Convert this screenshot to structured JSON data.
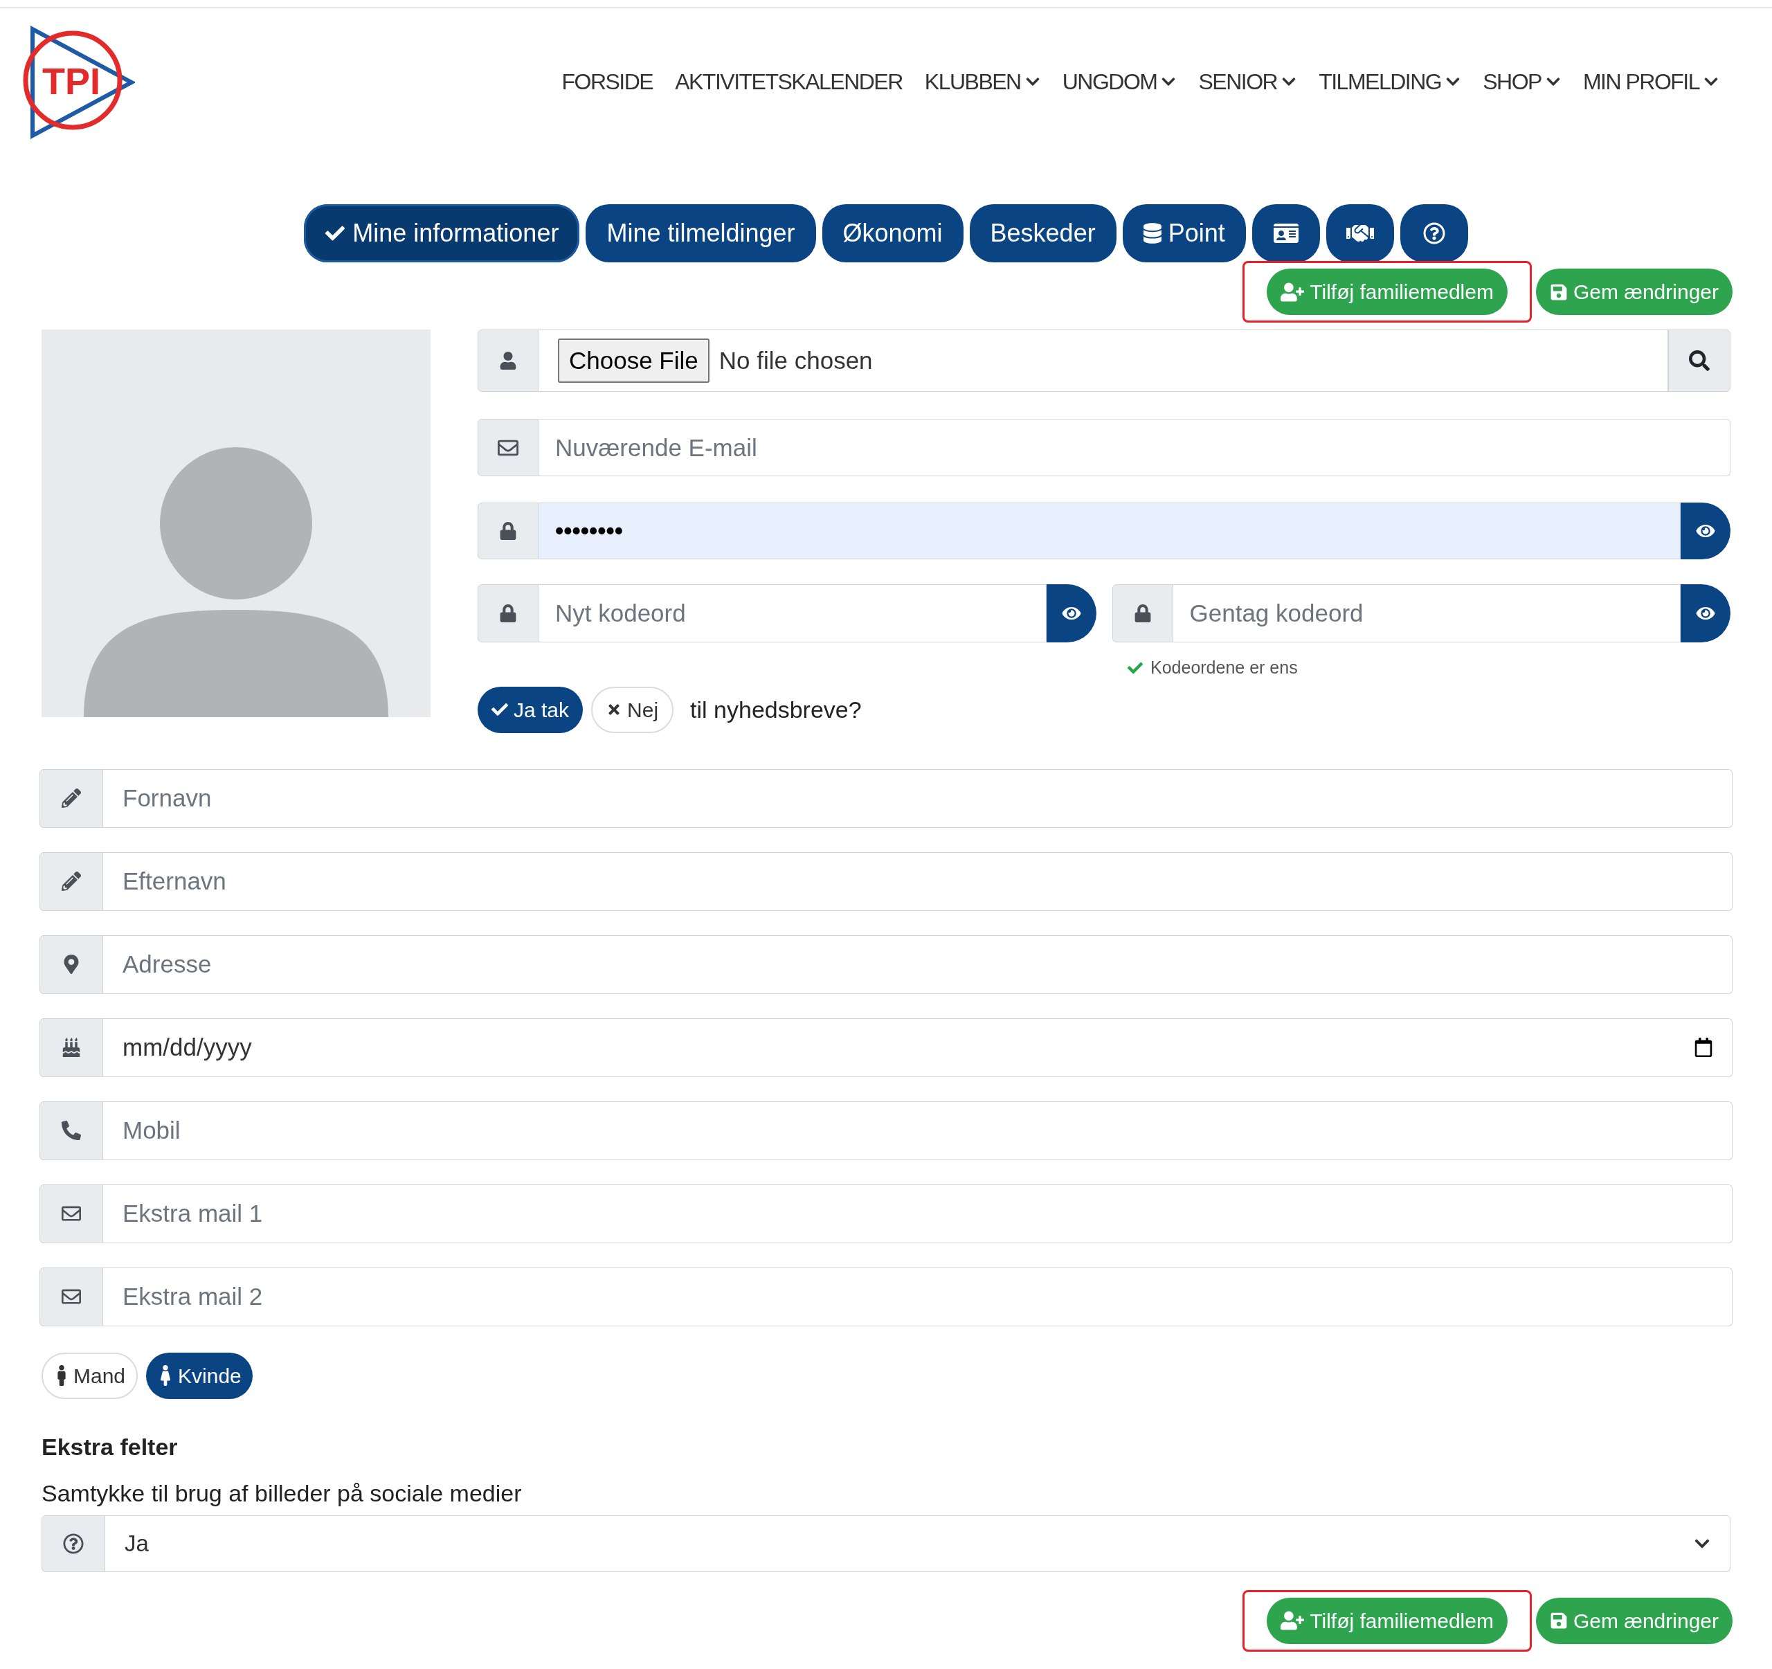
{
  "logo": {
    "text": "TPI"
  },
  "nav": [
    {
      "label": "FORSIDE",
      "dropdown": false
    },
    {
      "label": "AKTIVITETSKALENDER",
      "dropdown": false
    },
    {
      "label": "KLUBBEN",
      "dropdown": true
    },
    {
      "label": "UNGDOM",
      "dropdown": true
    },
    {
      "label": "SENIOR",
      "dropdown": true
    },
    {
      "label": "TILMELDING",
      "dropdown": true
    },
    {
      "label": "SHOP",
      "dropdown": true
    },
    {
      "label": "MIN PROFIL",
      "dropdown": true
    }
  ],
  "tabs": [
    {
      "kind": "text",
      "label": "Mine informationer",
      "selected": true
    },
    {
      "kind": "text",
      "label": "Mine tilmeldinger",
      "selected": false
    },
    {
      "kind": "text",
      "label": "Økonomi",
      "selected": false
    },
    {
      "kind": "text",
      "label": "Beskeder",
      "selected": false
    },
    {
      "kind": "database",
      "label": "Point",
      "selected": false
    },
    {
      "kind": "idcard",
      "selected": false
    },
    {
      "kind": "handshake",
      "selected": false
    },
    {
      "kind": "help",
      "selected": false
    }
  ],
  "actions_top": [
    {
      "kind": "add",
      "label": "Tilføj familiemedlem",
      "outlined": true
    },
    {
      "kind": "save",
      "label": "Gem ændringer",
      "outlined": false
    }
  ],
  "upload": {
    "button": "Choose File",
    "status": "No file chosen"
  },
  "email": {
    "placeholder": "Nuværende E-mail"
  },
  "password": {
    "value": "••••••••"
  },
  "new_password": {
    "placeholder": "Nyt kodeord"
  },
  "repeat_password": {
    "placeholder": "Gentag kodeord"
  },
  "match_hint": "Kodeordene er ens",
  "newsletter": {
    "options": [
      {
        "label": "Ja tak",
        "selected": true
      },
      {
        "label": "Nej",
        "selected": false
      }
    ],
    "question": "til nyhedsbreve?"
  },
  "fields": [
    {
      "kind": "name",
      "placeholder": "Fornavn"
    },
    {
      "kind": "name",
      "placeholder": "Efternavn"
    },
    {
      "kind": "address",
      "placeholder": "Adresse"
    },
    {
      "kind": "date",
      "value": "mm/dd/yyyy"
    },
    {
      "kind": "phone",
      "placeholder": "Mobil"
    },
    {
      "kind": "email",
      "placeholder": "Ekstra mail 1"
    },
    {
      "kind": "email",
      "placeholder": "Ekstra mail 2"
    }
  ],
  "gender": [
    {
      "kind": "male",
      "label": "Mand",
      "selected": false
    },
    {
      "kind": "female",
      "label": "Kvinde",
      "selected": true
    }
  ],
  "extra": {
    "heading": "Ekstra felter",
    "label": "Samtykke til brug af billeder på sociale medier",
    "value": "Ja"
  },
  "actions_bottom": [
    {
      "kind": "add",
      "label": "Tilføj familiemedlem",
      "outlined": true
    },
    {
      "kind": "save",
      "label": "Gem ændringer",
      "outlined": false
    }
  ]
}
